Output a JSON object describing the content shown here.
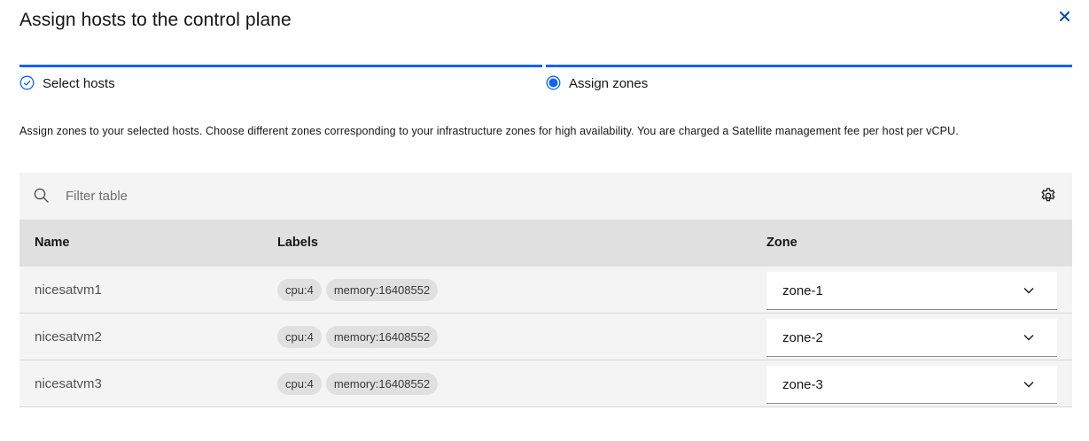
{
  "modal": {
    "title": "Assign hosts to the control plane",
    "close_icon": "close-icon"
  },
  "progress": {
    "steps": [
      {
        "label": "Select hosts",
        "state": "complete",
        "icon": "checkmark-outline-icon"
      },
      {
        "label": "Assign zones",
        "state": "current",
        "icon": "radio-selected-icon"
      }
    ]
  },
  "description": "Assign zones to your selected hosts. Choose different zones corresponding to your infrastructure zones for high availability. You are charged a Satellite management fee per host per vCPU.",
  "table": {
    "search": {
      "placeholder": "Filter table",
      "icon": "search-icon"
    },
    "settings_icon": "gear-icon",
    "headers": [
      "Name",
      "Labels",
      "Zone"
    ],
    "rows": [
      {
        "name": "nicesatvm1",
        "labels": [
          "cpu:4",
          "memory:16408552"
        ],
        "zone": "zone-1"
      },
      {
        "name": "nicesatvm2",
        "labels": [
          "cpu:4",
          "memory:16408552"
        ],
        "zone": "zone-2"
      },
      {
        "name": "nicesatvm3",
        "labels": [
          "cpu:4",
          "memory:16408552"
        ],
        "zone": "zone-3"
      }
    ]
  },
  "colors": {
    "accent": "#0f62fe",
    "text": "#161616",
    "muted_text": "#525252",
    "toolbar_bg": "#f4f4f4",
    "header_bg": "#e0e0e0",
    "tag_bg": "#e0e0e0"
  }
}
